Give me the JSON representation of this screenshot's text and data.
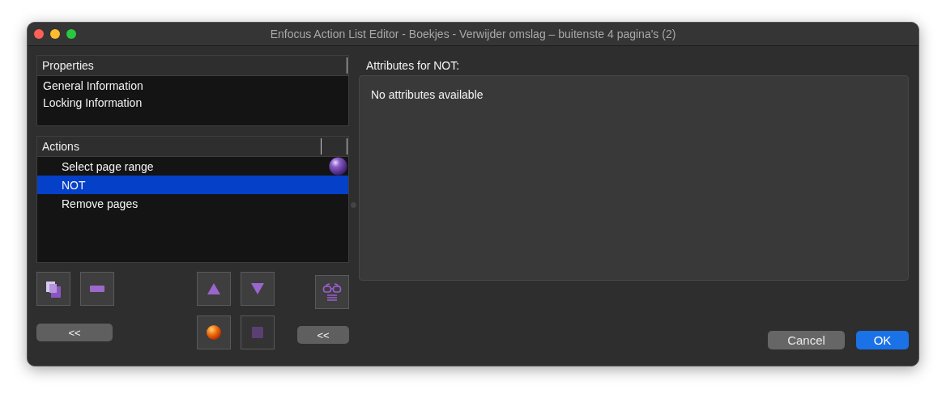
{
  "window": {
    "title": "Enfocus Action List Editor - Boekjes - Verwijder omslag – buitenste 4 pagina's (2)"
  },
  "properties": {
    "heading": "Properties",
    "items": [
      {
        "label": "General Information"
      },
      {
        "label": "Locking Information"
      }
    ]
  },
  "actions": {
    "heading": "Actions",
    "items": [
      {
        "label": "Select page range",
        "selected": false,
        "flagged": true
      },
      {
        "label": "NOT",
        "selected": true,
        "flagged": false
      },
      {
        "label": "Remove pages",
        "selected": false,
        "flagged": false
      }
    ]
  },
  "left_collapse": "<<",
  "right_collapse": "<<",
  "attributes": {
    "heading": "Attributes for NOT:",
    "message": "No attributes available"
  },
  "buttons": [
    {
      "label": "Cancel",
      "kind": "secondary"
    },
    {
      "label": "OK",
      "kind": "primary"
    }
  ]
}
